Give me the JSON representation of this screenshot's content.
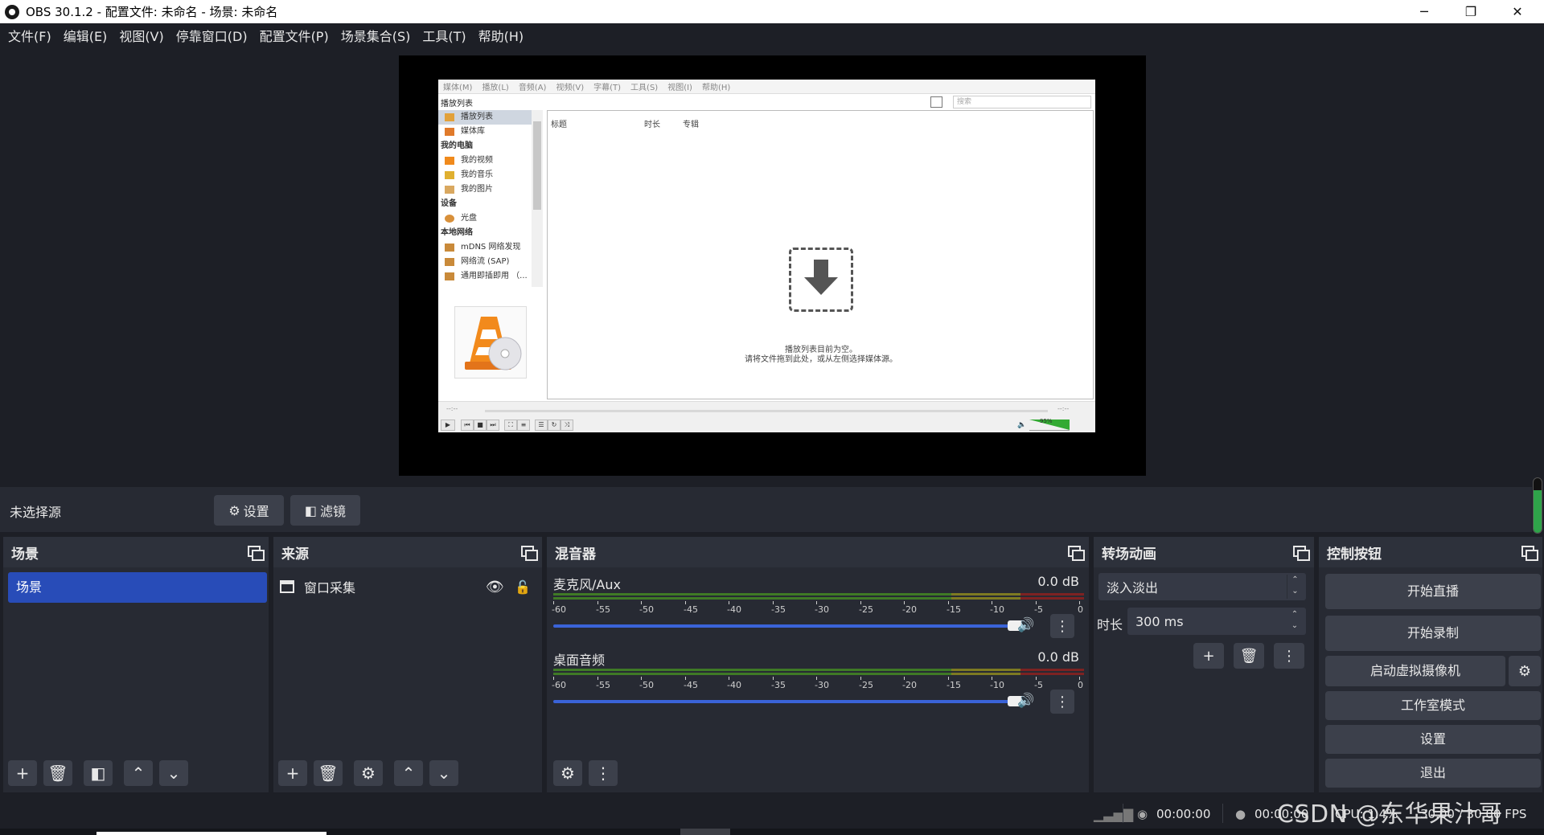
{
  "window": {
    "title": "OBS 30.1.2 - 配置文件: 未命名 - 场景: 未命名",
    "controls": [
      "─",
      "❐",
      "✕"
    ]
  },
  "menu": [
    "文件(F)",
    "编辑(E)",
    "视图(V)",
    "停靠窗口(D)",
    "配置文件(P)",
    "场景集合(S)",
    "工具(T)",
    "帮助(H)"
  ],
  "preview": {
    "vlc": {
      "menu": [
        "媒体(M)",
        "播放(L)",
        "音频(A)",
        "视频(V)",
        "字幕(T)",
        "工具(S)",
        "视图(I)",
        "帮助(H)"
      ],
      "playlist_header": "播放列表",
      "search_placeholder": "搜索",
      "sidebar": [
        {
          "label": "播放列表",
          "type": "item",
          "selected": true,
          "icon": "playlist-icon"
        },
        {
          "label": "媒体库",
          "type": "item",
          "icon": "library-icon"
        },
        {
          "label": "我的电脑",
          "type": "category"
        },
        {
          "label": "我的视频",
          "type": "item",
          "icon": "video-icon"
        },
        {
          "label": "我的音乐",
          "type": "item",
          "icon": "music-icon"
        },
        {
          "label": "我的图片",
          "type": "item",
          "icon": "picture-icon"
        },
        {
          "label": "设备",
          "type": "category"
        },
        {
          "label": "光盘",
          "type": "item",
          "icon": "disc-icon"
        },
        {
          "label": "本地网络",
          "type": "category"
        },
        {
          "label": "mDNS 网络发现",
          "type": "item",
          "icon": "network-icon"
        },
        {
          "label": "网络流 (SAP)",
          "type": "item",
          "icon": "network-icon"
        },
        {
          "label": "通用即插即用 （...",
          "type": "item",
          "icon": "network-icon"
        }
      ],
      "columns": [
        "标题",
        "时长",
        "专辑"
      ],
      "empty_line1": "播放列表目前为空。",
      "empty_line2": "请将文件拖到此处，或从左侧选择媒体源。",
      "time_left": "--:--",
      "time_right": "--:--",
      "volume": "95%"
    }
  },
  "source_toolbar": {
    "no_source": "未选择源",
    "settings": "设置",
    "filters": "滤镜"
  },
  "scenes": {
    "title": "场景",
    "items": [
      "场景"
    ]
  },
  "sources": {
    "title": "来源",
    "items": [
      {
        "label": "窗口采集",
        "visible": true,
        "locked": false
      }
    ]
  },
  "mixer": {
    "title": "混音器",
    "channels": [
      {
        "name": "麦克风/Aux",
        "db": "0.0 dB",
        "level": 0.0
      },
      {
        "name": "桌面音频",
        "db": "0.0 dB",
        "level": 0.0
      }
    ],
    "ticks": [
      "-60",
      "-55",
      "-50",
      "-45",
      "-40",
      "-35",
      "-30",
      "-25",
      "-20",
      "-15",
      "-10",
      "-5",
      "0"
    ]
  },
  "transitions": {
    "title": "转场动画",
    "selected": "淡入淡出",
    "duration_label": "时长",
    "duration_value": "300 ms"
  },
  "controls": {
    "title": "控制按钮",
    "start_stream": "开始直播",
    "start_record": "开始录制",
    "virtual_cam": "启动虚拟摄像机",
    "studio_mode": "工作室模式",
    "settings": "设置",
    "exit": "退出"
  },
  "status": {
    "stream_time": "00:00:00",
    "record_time": "00:00:00",
    "cpu": "CPU: 1.4%",
    "fps": "30.00 / 30.00 FPS"
  },
  "watermark": "CSDN @东华果汁哥",
  "colors": {
    "bg": "#1d1f26",
    "panel": "#272a33",
    "accent": "#284cb8",
    "slider": "#3a63d8"
  }
}
